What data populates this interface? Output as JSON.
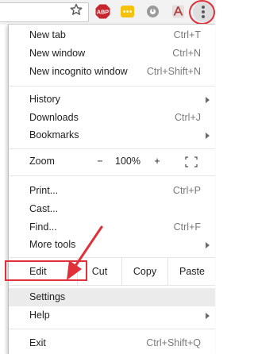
{
  "toolbar": {
    "icons": [
      "star-icon",
      "adblock-plus-icon",
      "yellow-extension-icon",
      "gray-extension-icon",
      "pdf-icon",
      "chrome-menu-icon"
    ],
    "abp_text": "ABP",
    "accent_colors": {
      "annotation_red": "#e0303a",
      "abp_red": "#c8262e",
      "yellow": "#f4c20d",
      "pdf_red": "#b04040"
    }
  },
  "menu": {
    "new_tab": {
      "label": "New tab",
      "shortcut": "Ctrl+T"
    },
    "new_window": {
      "label": "New window",
      "shortcut": "Ctrl+N"
    },
    "incognito": {
      "label": "New incognito window",
      "shortcut": "Ctrl+Shift+N"
    },
    "history": {
      "label": "History"
    },
    "downloads": {
      "label": "Downloads",
      "shortcut": "Ctrl+J"
    },
    "bookmarks": {
      "label": "Bookmarks"
    },
    "zoom": {
      "label": "Zoom",
      "minus": "−",
      "value": "100%",
      "plus": "+"
    },
    "print": {
      "label": "Print...",
      "shortcut": "Ctrl+P"
    },
    "cast": {
      "label": "Cast..."
    },
    "find": {
      "label": "Find...",
      "shortcut": "Ctrl+F"
    },
    "more_tools": {
      "label": "More tools"
    },
    "edit": {
      "label": "Edit",
      "cut": "Cut",
      "copy": "Copy",
      "paste": "Paste"
    },
    "settings": {
      "label": "Settings"
    },
    "help": {
      "label": "Help"
    },
    "exit": {
      "label": "Exit",
      "shortcut": "Ctrl+Shift+Q"
    }
  }
}
